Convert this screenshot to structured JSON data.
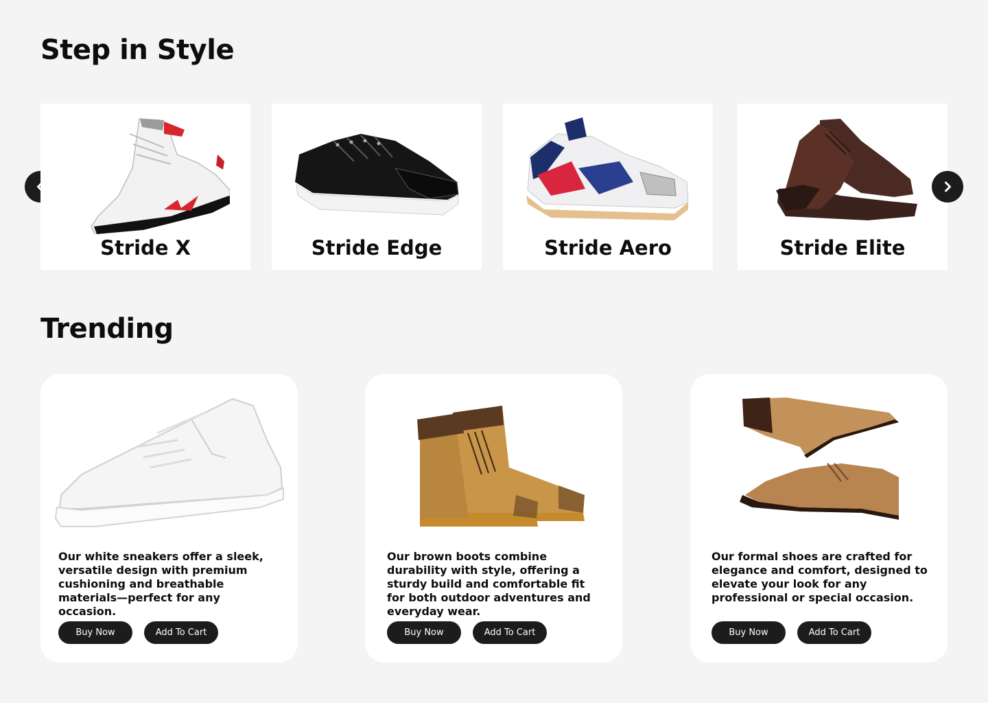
{
  "section_carousel": {
    "title": "Step in Style",
    "items": [
      {
        "name": "Stride X",
        "image": "white-red-basketball-sneaker"
      },
      {
        "name": "Stride Edge",
        "image": "black-suede-sneaker"
      },
      {
        "name": "Stride Aero",
        "image": "colorful-running-sneaker"
      },
      {
        "name": "Stride Elite",
        "image": "brown-leather-shoe"
      }
    ],
    "prev_icon": "chevron-left-icon",
    "next_icon": "chevron-right-icon"
  },
  "section_trending": {
    "title": "Trending",
    "cards": [
      {
        "image": "white-sneaker",
        "description": "Our white sneakers offer a sleek, versatile design with premium cushioning and breathable materials—perfect for any occasion.",
        "buy_label": "Buy Now",
        "cart_label": "Add To Cart"
      },
      {
        "image": "brown-boots",
        "description": "Our brown boots combine durability with style, offering a sturdy build and comfortable fit for both outdoor adventures and everyday wear.",
        "buy_label": "Buy Now",
        "cart_label": "Add To Cart"
      },
      {
        "image": "formal-shoes",
        "description": " Our formal shoes are crafted for elegance and comfort, designed to elevate your look for any professional or special occasion.",
        "buy_label": "Buy Now",
        "cart_label": "Add To Cart"
      }
    ]
  },
  "colors": {
    "background": "#f4f4f4",
    "card": "#ffffff",
    "button": "#1c1c1c",
    "button_text": "#ffffff"
  }
}
